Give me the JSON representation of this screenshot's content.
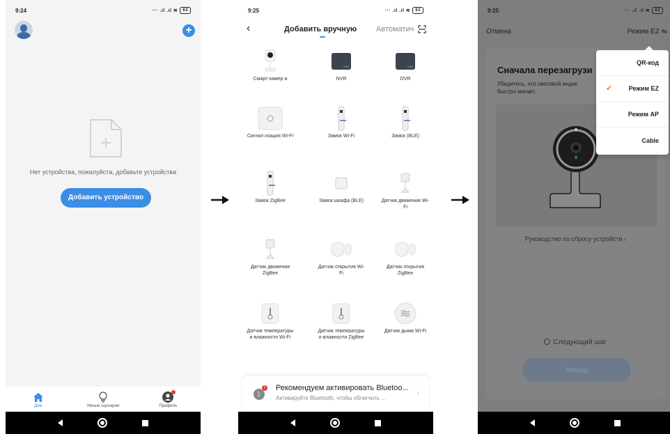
{
  "screen1": {
    "time": "9:24",
    "battery": "63",
    "empty_message": "Нет устройства, пожалуйста, добавьте устройства",
    "add_device_button": "Добавить устройство",
    "tabs": [
      {
        "label": "Дом",
        "icon": "home-icon",
        "active": true
      },
      {
        "label": "Умные сценарии",
        "icon": "bulb-icon",
        "active": false
      },
      {
        "label": "Профиль",
        "icon": "profile-icon",
        "active": false
      }
    ]
  },
  "screen2": {
    "time": "9:25",
    "battery": "63",
    "tab_manual": "Добавить вручную",
    "tab_auto": "Автоматич",
    "devices": [
      {
        "label": "Смарт-камер а",
        "icon": "camera-icon"
      },
      {
        "label": "NVR",
        "icon": "nvr-icon",
        "badge": "NVR"
      },
      {
        "label": "DVR",
        "icon": "dvr-icon",
        "badge": "DVR"
      },
      {
        "label": "Сигнал изация Wi-Fi",
        "icon": "alarm-hub-icon"
      },
      {
        "label": "Замок Wi-Fi",
        "icon": "lock-icon"
      },
      {
        "label": "Замок (BLE)",
        "icon": "lock-icon"
      },
      {
        "label": "Замок ZigBee",
        "icon": "lock-icon"
      },
      {
        "label": "Замок шкафа (BLE)",
        "icon": "cabinet-lock-icon"
      },
      {
        "label": "Датчик движения Wi-Fi",
        "icon": "motion-sensor-icon"
      },
      {
        "label": "Датчик движения ZigBee",
        "icon": "motion-sensor-icon"
      },
      {
        "label": "Датчик открытия Wi-Fi",
        "icon": "door-sensor-icon"
      },
      {
        "label": "Датчик открытия ZigBee",
        "icon": "door-sensor-icon"
      },
      {
        "label": "Датчик температуры и влажности Wi-Fi",
        "icon": "thermometer-icon"
      },
      {
        "label": "Датчик температуры и влажности ZigBee",
        "icon": "thermometer-icon"
      },
      {
        "label": "Датчик дыма Wi-Fi",
        "icon": "smoke-sensor-icon"
      }
    ],
    "bluetooth_title": "Рекомендуем активировать Bluetoo...",
    "bluetooth_subtitle": "Активируйте Bluetooth, чтобы облегчить ..."
  },
  "screen3": {
    "time": "9:25",
    "battery": "63",
    "cancel": "Отмена",
    "mode": "Режим EZ",
    "title": "Сначала перезагрузи",
    "description": "Убедитесь, что световой индик быстро мигает.",
    "reset_guide": "Руководство по сбросу устройств",
    "next_step": "Следующий шаг",
    "next_button": "Вперед",
    "menu": [
      {
        "label": "QR-код",
        "checked": false
      },
      {
        "label": "Режим EZ",
        "checked": true
      },
      {
        "label": "Режим AP",
        "checked": false
      },
      {
        "label": "Cable",
        "checked": false
      }
    ]
  }
}
